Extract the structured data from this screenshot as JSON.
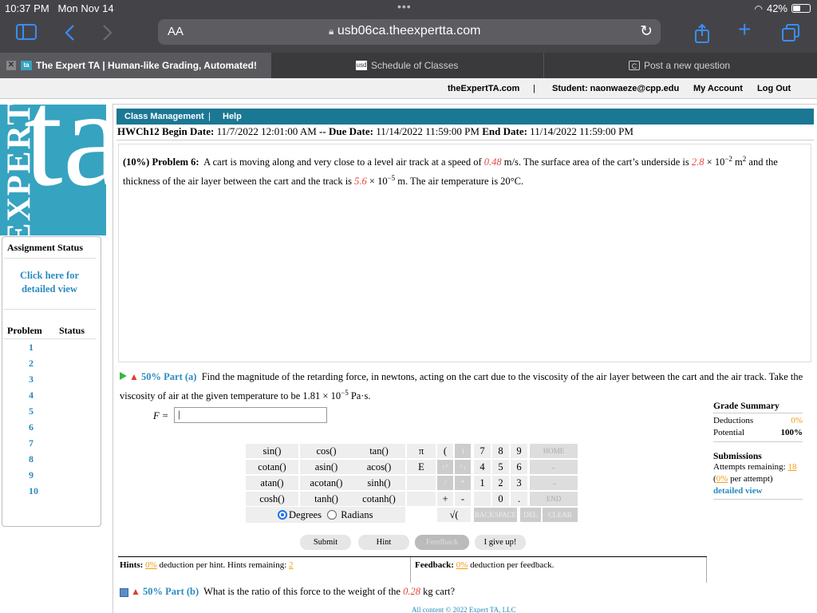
{
  "status_bar": {
    "time": "10:37 PM",
    "date": "Mon Nov 14",
    "battery": "42%"
  },
  "safari": {
    "aa_label": "AA",
    "url": "usb06ca.theexpertta.com"
  },
  "tabs": [
    {
      "label": "The Expert TA | Human-like Grading, Automated!",
      "active": true
    },
    {
      "label": "Schedule of Classes",
      "active": false
    },
    {
      "label": "Post a new question",
      "active": false
    }
  ],
  "site_header": {
    "home_link": "theExpertTA.com",
    "separator": "|",
    "student": "Student: naonwaeze@cpp.edu",
    "my_account": "My Account",
    "logout": "Log Out"
  },
  "logo": {
    "vertical_text": "EXPERT",
    "big_text": "ta"
  },
  "class_bar": {
    "class_management": "Class Management",
    "sep": "|",
    "help": "Help"
  },
  "assignment": {
    "name": "HWCh12",
    "begin_label": "Begin Date:",
    "begin_value": "11/7/2022 12:01:00 AM",
    "dash": "--",
    "due_label": "Due Date:",
    "due_value": "11/14/2022 11:59:00 PM",
    "end_label": "End Date:",
    "end_value": "11/14/2022 11:59:00 PM"
  },
  "sidebar": {
    "status_title": "Assignment Status",
    "detail_link_line1": "Click here for",
    "detail_link_line2": "detailed view",
    "col_problem": "Problem",
    "col_status": "Status",
    "problems": [
      "1",
      "2",
      "3",
      "4",
      "5",
      "6",
      "7",
      "8",
      "9",
      "10"
    ]
  },
  "problem": {
    "weight": "(10%)",
    "label": "Problem 6:",
    "text1": "A cart is moving along and very close to a level air track at a speed of",
    "speed": "0.48",
    "text2": "m/s. The surface area of the cart’s underside is",
    "area": "2.8",
    "text3": "× 10",
    "area_exp": "−2",
    "text4": "m",
    "m2": "2",
    "text5": "and the thickness of the air layer between the cart and the track is",
    "thickness": "5.6",
    "text6": "× 10",
    "thick_exp": "−5",
    "text7": "m. The air temperature is 20°C."
  },
  "part_a": {
    "percent": "50%",
    "label": "Part (a)",
    "text1": "Find the magnitude of the retarding force, in newtons, acting on the cart due to the viscosity of the air layer between the cart and the air track. Take the viscosity of air at the given temperature to be 1.81 × 10",
    "exp": "−5",
    "text2": "Pa·s.",
    "var_label": "F =",
    "input_value": "|"
  },
  "calculator": {
    "functions": [
      [
        "sin()",
        "cos()",
        "tan()"
      ],
      [
        "cotan()",
        "asin()",
        "acos()"
      ],
      [
        "atan()",
        "acotan()",
        "sinh()"
      ],
      [
        "cosh()",
        "tanh()",
        "cotanh()"
      ]
    ],
    "col4": [
      "π",
      "E",
      "",
      ""
    ],
    "paren_open": "(",
    "paren_close": ")",
    "arrow_up": "↑^",
    "arrow_down": "^↓",
    "slash": "/",
    "star": "*",
    "plus": "+",
    "minus": "-",
    "sqrt": "√(",
    "digits": [
      [
        "7",
        "8",
        "9"
      ],
      [
        "4",
        "5",
        "6"
      ],
      [
        "1",
        "2",
        "3"
      ],
      [
        "",
        "0",
        "."
      ]
    ],
    "home": "HOME",
    "left": "←",
    "right": "→",
    "end": "END",
    "backspace": "BACKSPACE",
    "del": "DEL",
    "clear": "CLEAR",
    "degrees": "Degrees",
    "radians": "Radians"
  },
  "grade_summary": {
    "title": "Grade Summary",
    "deductions_label": "Deductions",
    "deductions_value": "0%",
    "potential_label": "Potential",
    "potential_value": "100%",
    "submissions_title": "Submissions",
    "attempts_label": "Attempts remaining:",
    "attempts_value": "18",
    "per_attempt_prefix": "(",
    "per_attempt_value": "0%",
    "per_attempt_suffix": "per attempt)",
    "detail_link": "detailed view"
  },
  "actions": {
    "submit": "Submit",
    "hint": "Hint",
    "feedback": "Feedback",
    "give_up": "I give up!"
  },
  "hints": {
    "label": "Hints:",
    "deduction": "0%",
    "text": "deduction per hint. Hints remaining:",
    "remaining": "2"
  },
  "feedback": {
    "label": "Feedback:",
    "deduction": "0%",
    "text": "deduction per feedback."
  },
  "part_b": {
    "percent": "50%",
    "label": "Part (b)",
    "text1": "What is the ratio of this force to the weight of the",
    "mass": "0.28",
    "text2": "kg cart?"
  },
  "footer": "All content © 2022 Expert TA, LLC",
  "colors": {
    "accent": "#1b7894",
    "logo_bg": "#36a3c0",
    "link": "#2a8bbf",
    "given_value": "#e8453c",
    "percent_orange": "#f39c12"
  }
}
